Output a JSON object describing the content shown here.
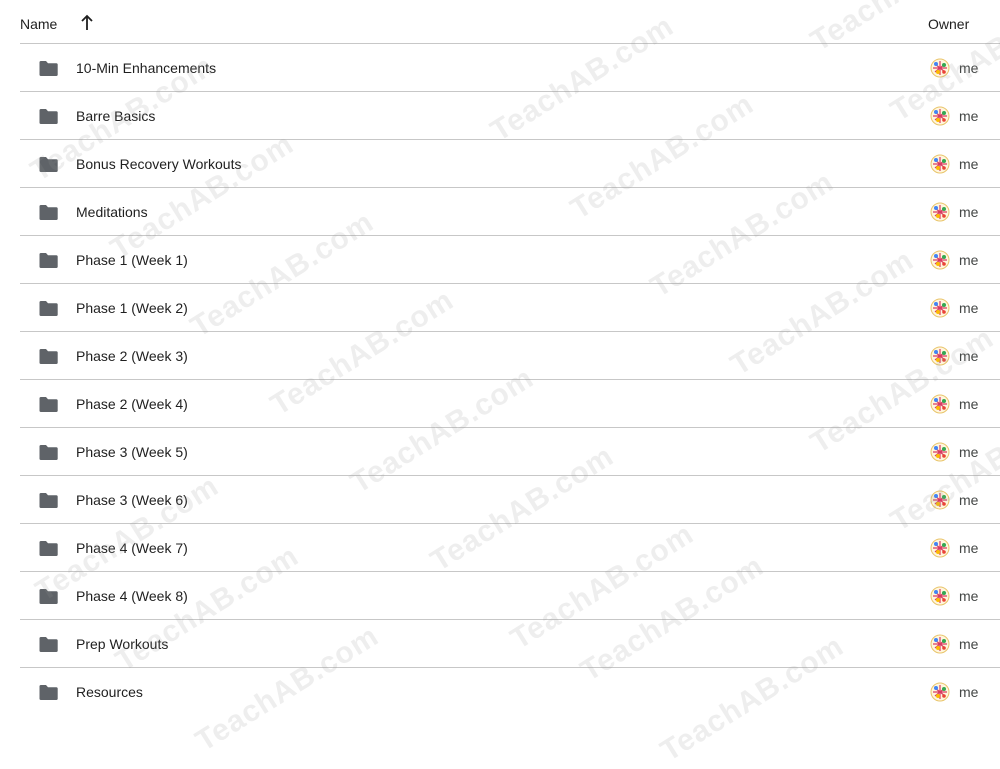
{
  "header": {
    "name_label": "Name",
    "owner_label": "Owner",
    "sort_icon": "arrow-up-icon"
  },
  "rows": [
    {
      "name": "10-Min Enhancements",
      "owner": "me",
      "icon": "folder-icon"
    },
    {
      "name": "Barre Basics",
      "owner": "me",
      "icon": "folder-icon"
    },
    {
      "name": "Bonus Recovery Workouts",
      "owner": "me",
      "icon": "folder-icon"
    },
    {
      "name": "Meditations",
      "owner": "me",
      "icon": "folder-icon"
    },
    {
      "name": "Phase 1 (Week 1)",
      "owner": "me",
      "icon": "folder-icon"
    },
    {
      "name": "Phase 1 (Week 2)",
      "owner": "me",
      "icon": "folder-icon"
    },
    {
      "name": "Phase 2 (Week 3)",
      "owner": "me",
      "icon": "folder-icon"
    },
    {
      "name": "Phase 2 (Week 4)",
      "owner": "me",
      "icon": "folder-icon"
    },
    {
      "name": "Phase 3 (Week 5)",
      "owner": "me",
      "icon": "folder-icon"
    },
    {
      "name": "Phase 3 (Week 6)",
      "owner": "me",
      "icon": "folder-icon"
    },
    {
      "name": "Phase 4 (Week 7)",
      "owner": "me",
      "icon": "folder-icon"
    },
    {
      "name": "Phase 4 (Week 8)",
      "owner": "me",
      "icon": "folder-icon"
    },
    {
      "name": "Prep Workouts",
      "owner": "me",
      "icon": "folder-icon"
    },
    {
      "name": "Resources",
      "owner": "me",
      "icon": "folder-icon"
    }
  ],
  "watermark": {
    "text": "TeachAB.com"
  },
  "colors": {
    "text": "#1f1f1f",
    "folder": "#5f6368",
    "divider": "#c7c7c7",
    "owner_text": "#444746"
  }
}
